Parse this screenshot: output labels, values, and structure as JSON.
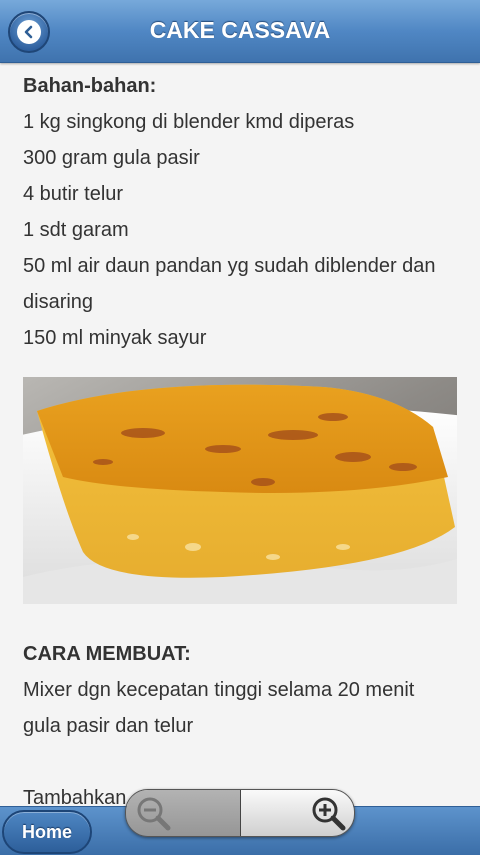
{
  "header": {
    "title": "CAKE CASSAVA",
    "back_icon": "back-arrow-icon"
  },
  "ingredients": {
    "heading": "Bahan-bahan:",
    "lines": [
      "1 kg singkong di blender kmd diperas",
      "300 gram gula pasir",
      "4 butir telur",
      "1 sdt garam",
      "50 ml air daun pandan yg sudah diblender dan",
      "disaring",
      "150 ml minyak sayur"
    ]
  },
  "photo": {
    "description": "cake-cassava-photo"
  },
  "method": {
    "heading": "CARA MEMBUAT:",
    "lines": [
      "Mixer dgn kecepatan tinggi selama 20 menit",
      "gula pasir dan telur",
      "Tambahkan ... diblender dan"
    ]
  },
  "footer": {
    "home_label": "Home"
  },
  "zoom": {
    "out_icon": "zoom-out-icon",
    "in_icon": "zoom-in-icon"
  },
  "colors": {
    "header": "#5087c4",
    "footer": "#3b6ea8",
    "text": "#333333"
  }
}
